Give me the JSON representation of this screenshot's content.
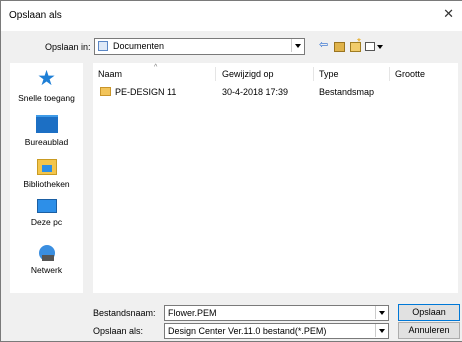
{
  "window": {
    "title": "Opslaan als",
    "close_glyph": "✕"
  },
  "lookin": {
    "label": "Opslaan in:",
    "value": "Documenten"
  },
  "toolbar": {
    "back_glyph": "⇦"
  },
  "places": [
    {
      "label": "Snelle toegang",
      "icon": "quick-access-star-icon"
    },
    {
      "label": "Bureaublad",
      "icon": "desktop-icon"
    },
    {
      "label": "Bibliotheken",
      "icon": "libraries-icon"
    },
    {
      "label": "Deze pc",
      "icon": "this-pc-icon"
    },
    {
      "label": "Netwerk",
      "icon": "network-icon"
    }
  ],
  "columns": {
    "name": "Naam",
    "modified": "Gewijzigd op",
    "type": "Type",
    "size": "Grootte"
  },
  "files": [
    {
      "name": "PE-DESIGN 11",
      "modified": "30-4-2018 17:39",
      "type": "Bestandsmap"
    }
  ],
  "filename": {
    "label": "Bestandsnaam:",
    "value": "Flower.PEM"
  },
  "filetype": {
    "label": "Opslaan als:",
    "value": "Design Center Ver.11.0 bestand(*.PEM)"
  },
  "buttons": {
    "save": "Opslaan",
    "cancel": "Annuleren"
  }
}
